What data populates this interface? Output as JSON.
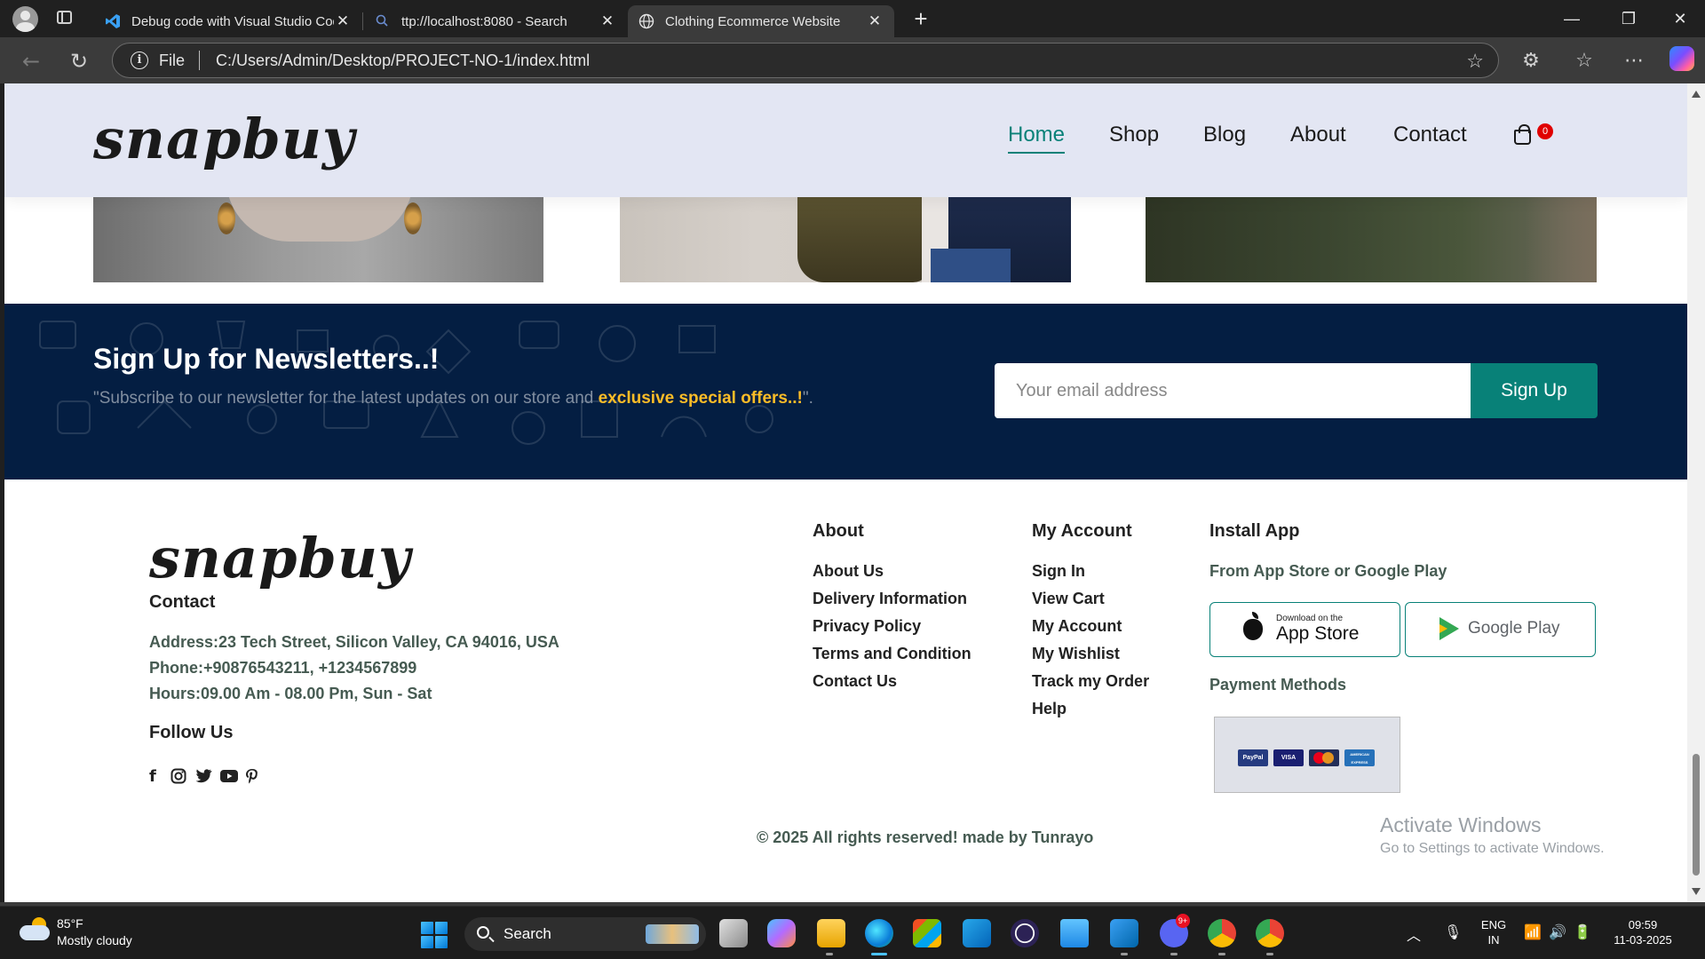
{
  "browser": {
    "tabs": [
      {
        "title": "Debug code with Visual Studio Code",
        "icon": "vscode-icon"
      },
      {
        "title": "ttp://localhost:8080 - Search",
        "icon": "search-icon"
      },
      {
        "title": "Clothing Ecommerce Website",
        "icon": "globe-icon"
      }
    ],
    "active_tab": 2,
    "address": {
      "scheme_label": "File",
      "url": "C:/Users/Admin/Desktop/PROJECT-NO-1/index.html"
    }
  },
  "site": {
    "logo": "snapbuy",
    "nav": [
      {
        "label": "Home",
        "active": true
      },
      {
        "label": "Shop",
        "active": false
      },
      {
        "label": "Blog",
        "active": false
      },
      {
        "label": "About",
        "active": false
      },
      {
        "label": "Contact",
        "active": false
      }
    ],
    "cart_count": "0",
    "accent_color": "#088178",
    "header_bg": "#e3e6f3"
  },
  "newsletter": {
    "title": "Sign Up for Newsletters..!",
    "text_prefix": "\"Subscribe to our newsletter for the latest updates on our store and ",
    "text_highlight": "exclusive special offers..!",
    "text_suffix": "\".",
    "placeholder": "Your email address",
    "button": "Sign Up",
    "bg_color": "#041e42",
    "highlight_color": "#ffbd27"
  },
  "footer": {
    "logo": "snapbuy",
    "contact": {
      "heading": "Contact",
      "address": "Address:23 Tech Street, Silicon Valley, CA 94016, USA",
      "phone": "Phone:+90876543211, +1234567899",
      "hours": "Hours:09.00 Am - 08.00 Pm, Sun - Sat"
    },
    "follow": {
      "heading": "Follow Us",
      "icons": [
        "facebook-icon",
        "instagram-icon",
        "twitter-icon",
        "youtube-icon",
        "pinterest-icon"
      ]
    },
    "about": {
      "heading": "About",
      "links": [
        "About Us",
        "Delivery Information",
        "Privacy Policy",
        "Terms and Condition",
        "Contact Us"
      ]
    },
    "account": {
      "heading": "My Account",
      "links": [
        "Sign In",
        "View Cart",
        "My Account",
        "My Wishlist",
        "Track my Order",
        "Help"
      ]
    },
    "app": {
      "heading": "Install App",
      "subtitle": "From App Store or Google Play",
      "appstore_small": "Download on the",
      "appstore_big": "App Store",
      "googleplay": "Google Play",
      "payment_heading": "Payment Methods",
      "cards": [
        "PayPal",
        "VISA",
        "mastercard",
        "AMERICAN EXPRESS"
      ]
    },
    "copyright": "© 2025 All rights reserved! made by Tunrayo"
  },
  "watermark": {
    "line1": "Activate Windows",
    "line2": "Go to Settings to activate Windows."
  },
  "taskbar": {
    "weather_temp": "85°F",
    "weather_desc": "Mostly cloudy",
    "search_label": "Search",
    "lang1": "ENG",
    "lang2": "IN",
    "time": "09:59",
    "date": "11-03-2025",
    "discord_badge": "9+"
  }
}
